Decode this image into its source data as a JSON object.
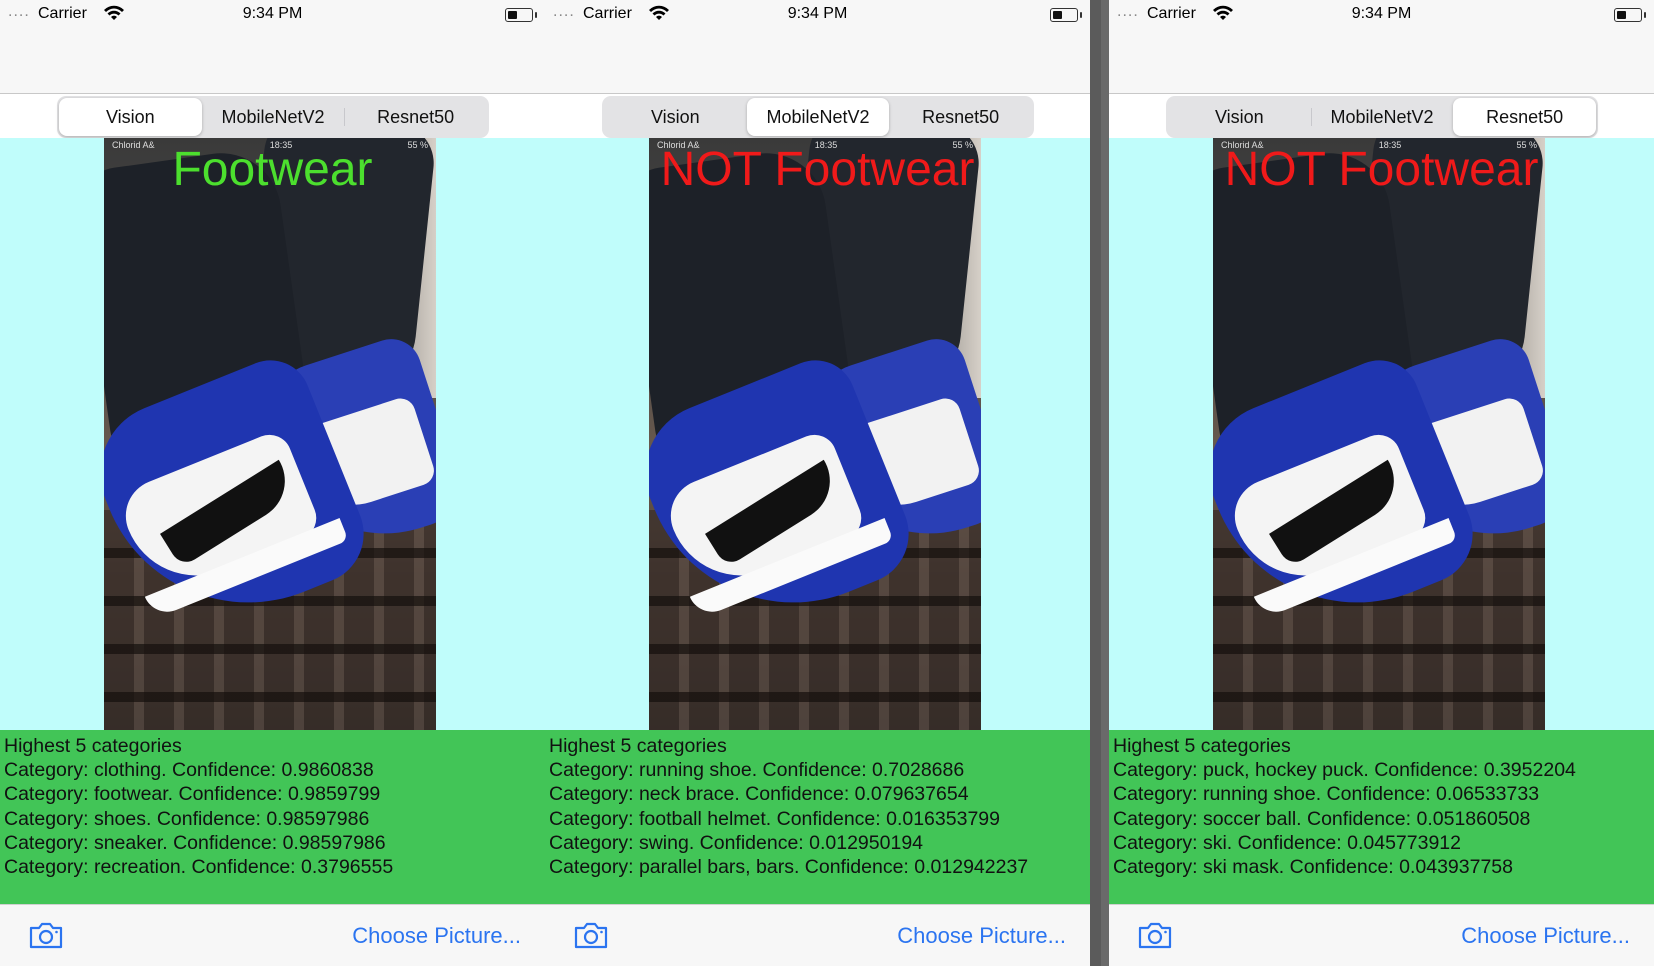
{
  "status": {
    "signal": "....",
    "carrier": "Carrier",
    "time": "9:34 PM"
  },
  "segments": [
    "Vision",
    "MobileNetV2",
    "Resnet50"
  ],
  "photo_status": {
    "carrier": "Chlorid A&",
    "time": "18:35",
    "battery": "55 %"
  },
  "footer": {
    "choose_label": "Choose Picture..."
  },
  "colors": {
    "ok": "#4cdf2e",
    "bad": "#f01a1a",
    "results_bg": "#42c557",
    "image_bg": "#c0fdfb",
    "link": "#2b74f0"
  },
  "panels": [
    {
      "selected": "Vision",
      "verdict": "Footwear",
      "verdict_color": "ok",
      "header": "Highest 5 categories",
      "results": [
        "Category: clothing. Confidence: 0.9860838",
        "Category: footwear. Confidence: 0.9859799",
        "Category: shoes. Confidence: 0.98597986",
        "Category: sneaker. Confidence: 0.98597986",
        "Category: recreation. Confidence: 0.3796555"
      ]
    },
    {
      "selected": "MobileNetV2",
      "verdict": "NOT Footwear",
      "verdict_color": "bad",
      "header": "Highest 5 categories",
      "results": [
        "Category: running shoe. Confidence: 0.7028686",
        "Category: neck brace. Confidence: 0.079637654",
        "Category: football helmet. Confidence: 0.016353799",
        "Category: swing. Confidence: 0.012950194",
        "Category: parallel bars, bars. Confidence: 0.012942237"
      ]
    },
    {
      "selected": "Resnet50",
      "verdict": "NOT Footwear",
      "verdict_color": "bad",
      "header": "Highest 5 categories",
      "results": [
        "Category: puck, hockey puck. Confidence: 0.3952204",
        "Category: running shoe. Confidence: 0.06533733",
        "Category: soccer ball. Confidence: 0.051860508",
        "Category: ski. Confidence: 0.045773912",
        "Category: ski mask. Confidence: 0.043937758"
      ]
    }
  ]
}
